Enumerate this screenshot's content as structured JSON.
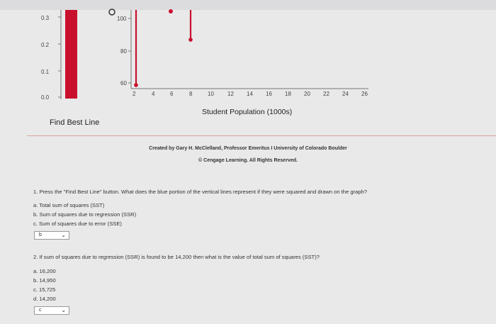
{
  "gauge": {
    "ticks": [
      "0.3",
      "0.2",
      "0.1",
      "0.0"
    ],
    "fill_color": "#c8102e"
  },
  "chart": {
    "y_ticks": [
      "100",
      "80",
      "60"
    ],
    "x_ticks": [
      "2",
      "4",
      "6",
      "8",
      "10",
      "12",
      "14",
      "16",
      "18",
      "20",
      "22",
      "24",
      "26"
    ],
    "x_title": "Student Population (1000s)",
    "line_color": "#c8102e"
  },
  "find_best_line_label": "Find Best Line",
  "credit": {
    "line1": "Created by Gary H. McClelland, Professor Emeritus I University of Colorado Boulder",
    "line2": "© Cengage Learning. All Rights Reserved."
  },
  "question1": {
    "text": "1. Press the \"Find Best Line\" button. What does the blue portion of the vertical lines represent if they were squared and drawn on the graph?",
    "options": [
      "a. Total sum of squares (SST)",
      "b. Sum of squares due to regression (SSR)",
      "c. Sum of squares due to error (SSE)"
    ],
    "selected": "b"
  },
  "question2": {
    "text": "2. If sum of squares due to regression (SSR) is found to be 14,200 then what is the value of total sum of squares (SST)?",
    "options": [
      "a. 16,200",
      "b. 14,950",
      "c. 15,725",
      "d. 14,200"
    ],
    "selected": "c"
  },
  "icons": {
    "dropdown": "chevron-down-icon",
    "cursor": "circle-handle-icon"
  }
}
